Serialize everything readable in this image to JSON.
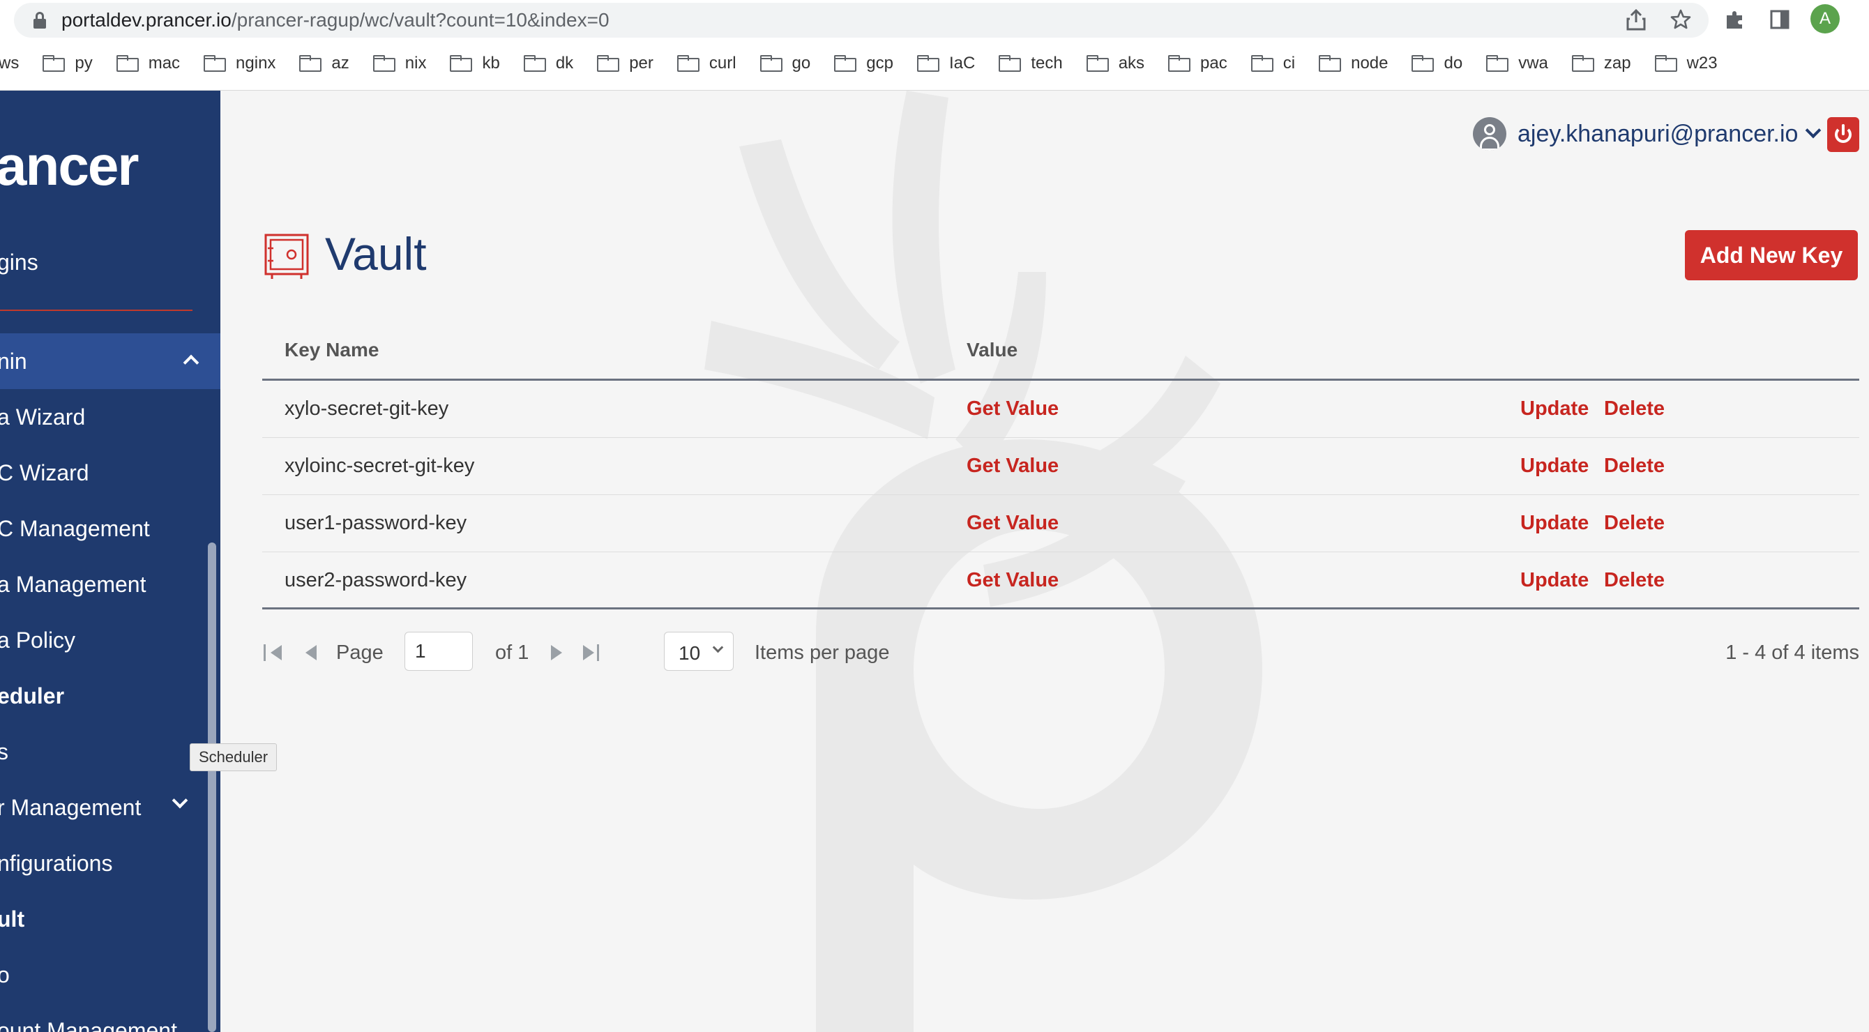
{
  "browser": {
    "url_host": "portaldev.prancer.io",
    "url_path": "/prancer-ragup/wc/vault?count=10&index=0",
    "profile_initial": "A",
    "bookmarks": [
      "ws",
      "py",
      "mac",
      "nginx",
      "az",
      "nix",
      "kb",
      "dk",
      "per",
      "curl",
      "go",
      "gcp",
      "IaC",
      "tech",
      "aks",
      "pac",
      "ci",
      "node",
      "do",
      "vwa",
      "zap",
      "w23"
    ]
  },
  "sidebar": {
    "brand": "ancer",
    "items": [
      {
        "label": "gins"
      },
      {
        "label": "nin"
      },
      {
        "label": "a Wizard"
      },
      {
        "label": "C Wizard"
      },
      {
        "label": "C Management"
      },
      {
        "label": "a Management"
      },
      {
        "label": "a Policy"
      },
      {
        "label": "eduler"
      },
      {
        "label": "s"
      },
      {
        "label": "r Management"
      },
      {
        "label": "nfigurations"
      },
      {
        "label": "ult"
      },
      {
        "label": "o"
      },
      {
        "label": "ount Management"
      }
    ],
    "tooltip": "Scheduler"
  },
  "header": {
    "user_email": "ajey.khanapuri@prancer.io"
  },
  "page": {
    "title": "Vault",
    "add_button": "Add New Key"
  },
  "table": {
    "columns": [
      "Key Name",
      "Value"
    ],
    "rows": [
      {
        "key": "xylo-secret-git-key",
        "value_action": "Get Value",
        "update": "Update",
        "delete": "Delete"
      },
      {
        "key": "xyloinc-secret-git-key",
        "value_action": "Get Value",
        "update": "Update",
        "delete": "Delete"
      },
      {
        "key": "user1-password-key",
        "value_action": "Get Value",
        "update": "Update",
        "delete": "Delete"
      },
      {
        "key": "user2-password-key",
        "value_action": "Get Value",
        "update": "Update",
        "delete": "Delete"
      }
    ]
  },
  "pager": {
    "page_label": "Page",
    "page_value": "1",
    "of_label": "of 1",
    "page_size": "10",
    "items_per_page_label": "Items per page",
    "info": "1 - 4 of 4 items"
  },
  "colors": {
    "sidebar_bg": "#1f3a6e",
    "accent_red": "#d0312d",
    "link_red": "#c7251f",
    "title_blue": "#1f3a6e"
  }
}
